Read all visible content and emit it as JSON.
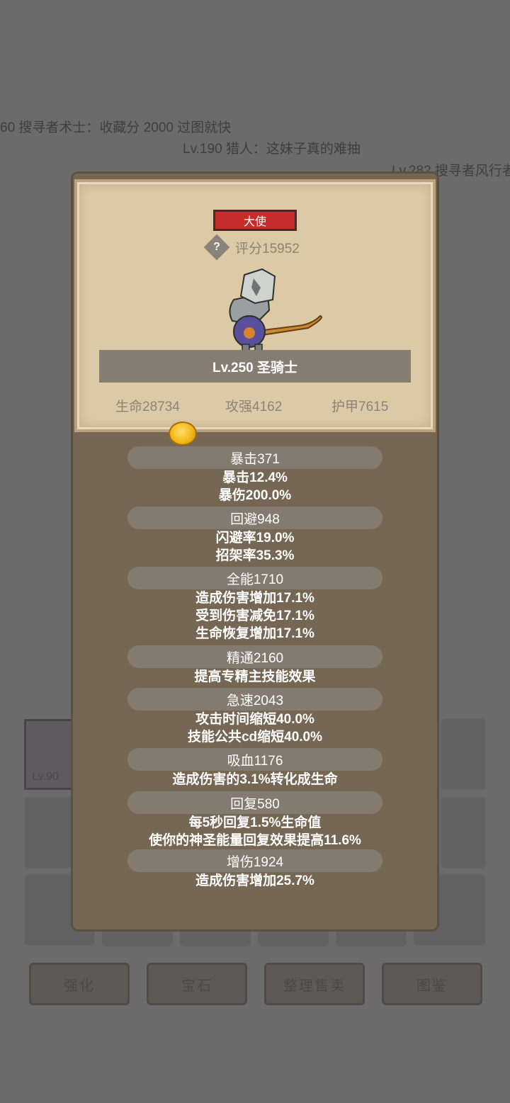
{
  "chat": {
    "line1": "60 搜寻者术士：收藏分 2000 过图就快",
    "line2": "Lv.190 猎人：这妹子真的难抽",
    "line3": "Lv.282 搜寻者风行者"
  },
  "background": {
    "item_level": "Lv.90",
    "buttons": [
      "强化",
      "宝石",
      "整理售卖",
      "图鉴"
    ]
  },
  "card": {
    "rank_label": "大使",
    "help_icon": "?",
    "score": "评分15952",
    "name": "Lv.250 圣骑士",
    "stats": {
      "hp": "生命28734",
      "atk": "攻强4162",
      "armor": "护甲7615"
    }
  },
  "attributes": [
    {
      "header": "暴击371",
      "lines": [
        "暴击12.4%",
        "暴伤200.0%"
      ]
    },
    {
      "header": "回避948",
      "lines": [
        "闪避率19.0%",
        "招架率35.3%"
      ]
    },
    {
      "header": "全能1710",
      "lines": [
        "造成伤害增加17.1%",
        "受到伤害减免17.1%",
        "生命恢复增加17.1%"
      ]
    },
    {
      "header": "精通2160",
      "lines": [
        "提高专精主技能效果"
      ]
    },
    {
      "header": "急速2043",
      "lines": [
        "攻击时间缩短40.0%",
        "技能公共cd缩短40.0%"
      ]
    },
    {
      "header": "吸血1176",
      "lines": [
        "造成伤害的3.1%转化成生命"
      ]
    },
    {
      "header": "回复580",
      "lines": [
        "每5秒回复1.5%生命值",
        "使你的神圣能量回复效果提高11.6%"
      ]
    },
    {
      "header": "增伤1924",
      "lines": [
        "造成伤害增加25.7%"
      ]
    }
  ],
  "colors": {
    "rank_red": "#c62d2a",
    "card_bg": "#dccaa7",
    "panel_bg": "#766754"
  }
}
